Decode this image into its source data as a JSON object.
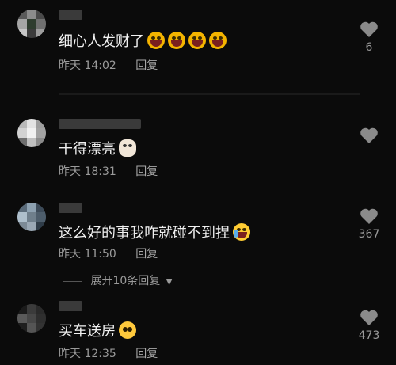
{
  "comments": [
    {
      "text": "细心人发财了",
      "emoji": [
        "laugh-cry-emoji",
        "laugh-cry-emoji",
        "laugh-cry-emoji",
        "laugh-cry-emoji"
      ],
      "time": "昨天 14:02",
      "reply": "回复",
      "likes": "6",
      "avatar_colors": [
        "#5a5a5a",
        "#8c8c8c",
        "#4a4a4a",
        "#a6a6a6",
        "#2f3d2f",
        "#707070",
        "#c7c7c7",
        "#3c3c3c",
        "#9e9e9e"
      ]
    },
    {
      "text": "干得漂亮",
      "emoji": [
        "cat-emoji"
      ],
      "time": "昨天 18:31",
      "reply": "回复",
      "likes": "",
      "avatar_colors": [
        "#b9b9b9",
        "#e3e3e3",
        "#9e9e9e",
        "#d2d2d2",
        "#f1f1f1",
        "#a3a3a3",
        "#6e6e6e",
        "#c0c0c0",
        "#8a8a8a"
      ]
    },
    {
      "text": "这么好的事我咋就碰不到捏",
      "emoji": [
        "laugh-cry-emoji"
      ],
      "time": "昨天 11:50",
      "reply": "回复",
      "likes": "367",
      "avatar_colors": [
        "#5a6b7a",
        "#8da1b1",
        "#3d4b59",
        "#aebfcc",
        "#6f7f8c",
        "#4d5d6b",
        "#7c8a96",
        "#9aa8b5",
        "#2f3c48"
      ]
    },
    {
      "text": "买车送房",
      "emoji": [
        "pleading-emoji"
      ],
      "time": "昨天 12:35",
      "reply": "回复",
      "likes": "473",
      "avatar_colors": [
        "#1b1b1b",
        "#3b3b3b",
        "#2a2a2a",
        "#5a5a5a",
        "#474747",
        "#2f2f2f",
        "#1f1f1f",
        "#555555",
        "#333333"
      ]
    }
  ],
  "expand_replies": "展开10条回复",
  "colors": {
    "background": "#0b0b0b",
    "text": "#f0f0f0",
    "meta": "#9a9a9a",
    "divider": "#3a3a3a"
  }
}
